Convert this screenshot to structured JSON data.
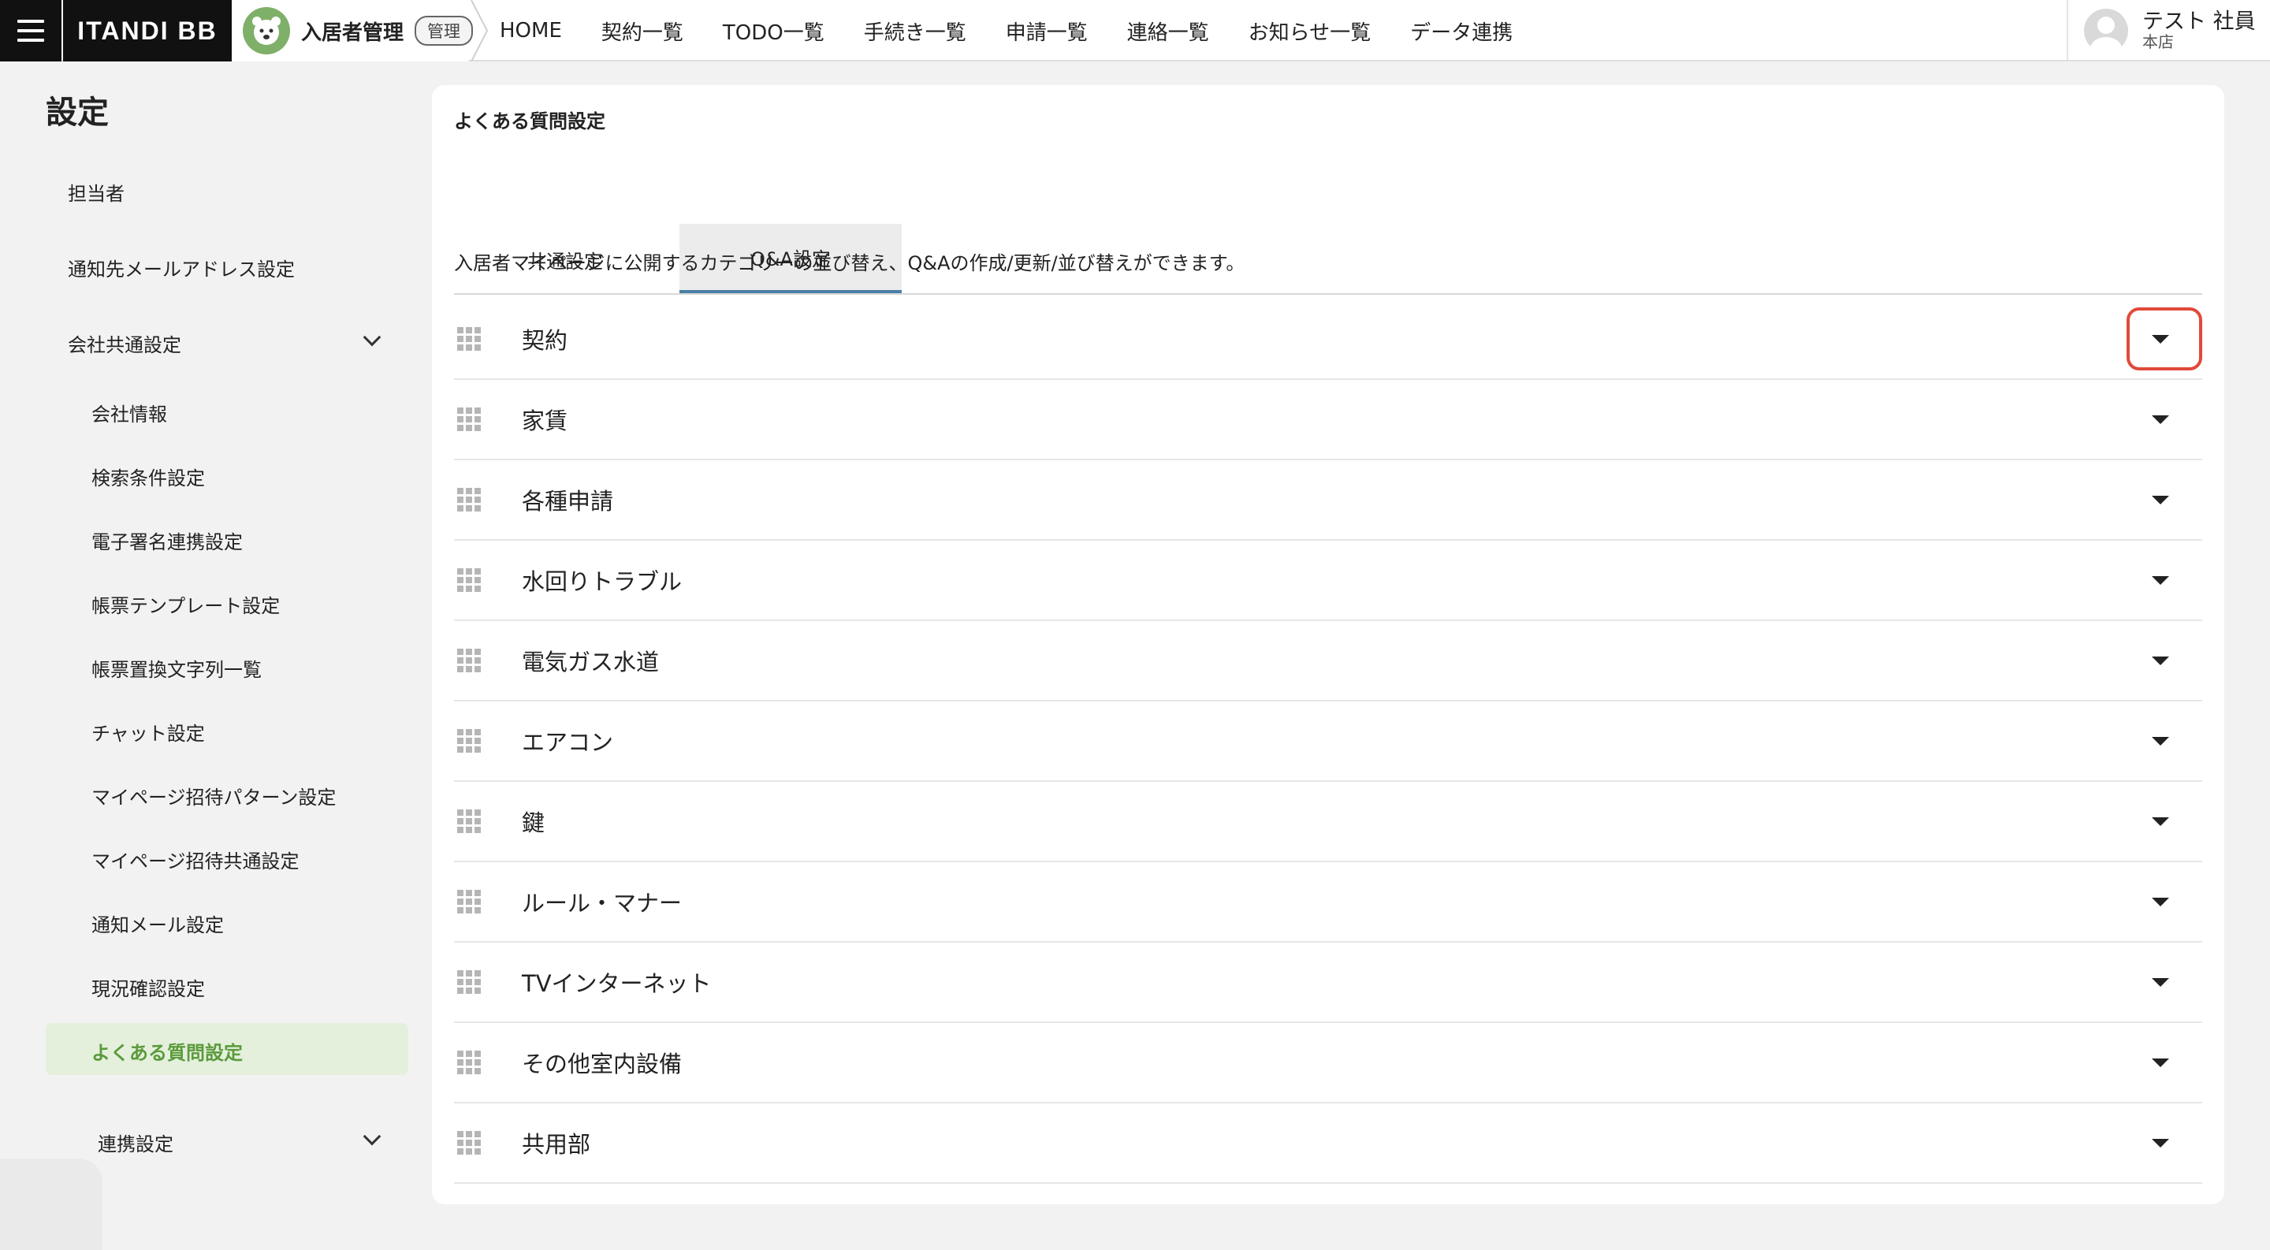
{
  "header": {
    "brand": "ITANDI BB",
    "product_name": "入居者管理",
    "admin_badge": "管理",
    "nav": [
      "HOME",
      "契約一覧",
      "TODO一覧",
      "手続き一覧",
      "申請一覧",
      "連絡一覧",
      "お知らせ一覧",
      "データ連携"
    ],
    "user_name": "テスト 社員",
    "user_branch": "本店"
  },
  "sidebar": {
    "title": "設定",
    "items": {
      "tantousha": "担当者",
      "notify_email": "通知先メールアドレス設定",
      "company_common": "会社共通設定",
      "company_info": "会社情報",
      "search_conditions": "検索条件設定",
      "esign": "電子署名連携設定",
      "form_template": "帳票テンプレート設定",
      "form_replace": "帳票置換文字列一覧",
      "chat": "チャット設定",
      "mypage_invite_pattern": "マイページ招待パターン設定",
      "mypage_invite_common": "マイページ招待共通設定",
      "notify_mail": "通知メール設定",
      "status_check": "現況確認設定",
      "faq": "よくある質問設定",
      "integration": "連携設定"
    }
  },
  "main": {
    "title": "よくある質問設定",
    "tabs": {
      "common": "共通設定",
      "qa": "Q&A設定"
    },
    "description": "入居者マイページに公開するカテゴリーの並び替え、Q&Aの作成/更新/並び替えができます。",
    "categories": [
      "契約",
      "家賃",
      "各種申請",
      "水回りトラブル",
      "電気ガス水道",
      "エアコン",
      "鍵",
      "ルール・マナー",
      "TVインターネット",
      "その他室内設備",
      "共用部"
    ]
  },
  "colors": {
    "accent_green": "#5b9a3c",
    "active_bg": "#e4f0dc",
    "tab_underline": "#4a7fa6",
    "highlight": "#e04a3a"
  }
}
